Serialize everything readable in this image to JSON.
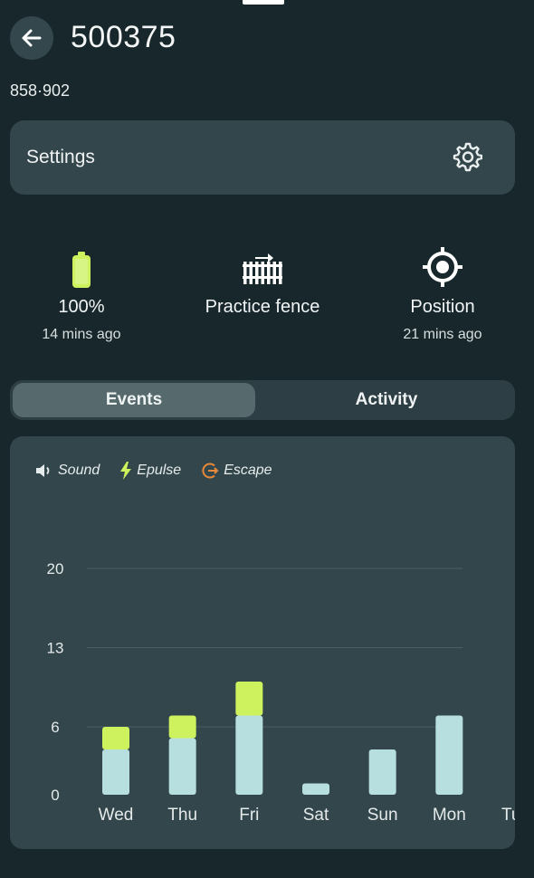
{
  "header": {
    "title": "500375",
    "subtitle": "858·902",
    "back_icon": "arrow-left-icon"
  },
  "settings": {
    "label": "Settings",
    "icon": "gear-icon"
  },
  "stats": {
    "battery": {
      "value": "100%",
      "updated": "14 mins ago",
      "icon": "battery-icon"
    },
    "fence": {
      "label": "Practice fence",
      "icon": "fence-icon"
    },
    "position": {
      "label": "Position",
      "updated": "21 mins ago",
      "icon": "crosshair-icon"
    }
  },
  "tabs": [
    {
      "label": "Events",
      "active": true
    },
    {
      "label": "Activity",
      "active": false
    }
  ],
  "legend": {
    "sound": "Sound",
    "epulse": "Epulse",
    "escape": "Escape"
  },
  "colors": {
    "sound": "#b7dfe0",
    "epulse": "#cdf25d",
    "escape": "#e98a3a",
    "background": "#18272c",
    "card": "#33464b"
  },
  "chart_data": {
    "type": "bar",
    "stacked": true,
    "categories": [
      "Wed",
      "Thu",
      "Fri",
      "Sat",
      "Sun",
      "Mon",
      "Tue"
    ],
    "series": [
      {
        "name": "Sound",
        "values": [
          4,
          5,
          7,
          1,
          4,
          7,
          0
        ]
      },
      {
        "name": "Epulse",
        "values": [
          2,
          2,
          3,
          0,
          0,
          0,
          0
        ]
      },
      {
        "name": "Escape",
        "values": [
          0,
          0,
          0,
          0,
          0,
          0,
          0
        ]
      }
    ],
    "yticks": [
      0,
      6,
      13,
      20
    ],
    "ylim": [
      0,
      20
    ],
    "grid": true,
    "legend_position": "top-left"
  }
}
